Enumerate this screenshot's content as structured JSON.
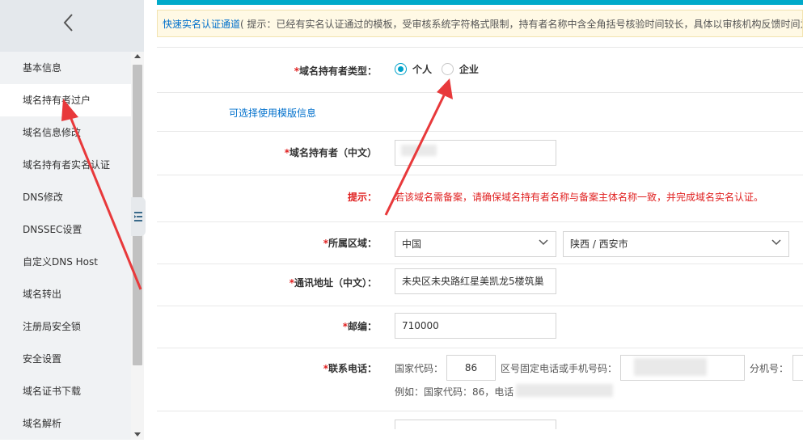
{
  "sidebar": {
    "back_icon": "chevron-left-icon",
    "items": [
      {
        "label": "基本信息"
      },
      {
        "label": "域名持有者过户"
      },
      {
        "label": "域名信息修改"
      },
      {
        "label": "域名持有者实名认证"
      },
      {
        "label": "DNS修改"
      },
      {
        "label": "DNSSEC设置"
      },
      {
        "label": "自定义DNS Host"
      },
      {
        "label": "域名转出"
      },
      {
        "label": "注册局安全锁"
      },
      {
        "label": "安全设置"
      },
      {
        "label": "域名证书下载"
      },
      {
        "label": "域名解析"
      }
    ],
    "active_index": 1
  },
  "notice": {
    "link": "快速实名认证通道",
    "text": "( 提示：已经有实名认证通过的模板，受审核系统字符格式限制，持有者名称中含全角括号核验时间较长，具体以审核机构反馈时间为准"
  },
  "form": {
    "holder_type": {
      "label": "域名持有者类型：",
      "options": [
        "个人",
        "企业"
      ],
      "selected": "个人"
    },
    "template_link": "可选择使用模版信息",
    "holder_cn": {
      "label": "域名持有者（中文）",
      "value": ""
    },
    "tip": {
      "label": "提示：",
      "text": "若该域名需备案，请确保域名持有者名称与备案主体名称一致，并完成域名实名认证。"
    },
    "region": {
      "label": "所属区域：",
      "country": "中国",
      "province_city": "陕西 / 西安市"
    },
    "address": {
      "label": "通讯地址（中文）：",
      "value": "未央区未央路红星美凯龙5楼筑巢"
    },
    "postcode": {
      "label": "邮编：",
      "value": "710000"
    },
    "phone": {
      "label": "联系电话：",
      "country_code_label": "国家代码：",
      "country_code": "86",
      "number_label": "区号固定电话或手机号码：",
      "ext_label": "分机号：",
      "example": "例如：国家代码：86，电话"
    }
  },
  "colors": {
    "accent": "#00a2ca",
    "link": "#0070cc",
    "required": "#e02020",
    "annotation_arrow": "#e8393b"
  }
}
